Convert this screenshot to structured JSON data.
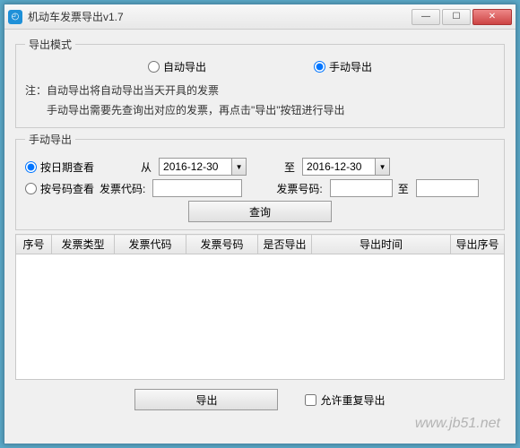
{
  "window": {
    "title": "机动车发票导出v1.7"
  },
  "export_mode": {
    "legend": "导出模式",
    "auto_label": "自动导出",
    "manual_label": "手动导出",
    "selected": "manual",
    "note_line1": "注：自动导出将自动导出当天开具的发票",
    "note_line2": "手动导出需要先查询出对应的发票，再点击\"导出\"按钮进行导出"
  },
  "manual_export": {
    "legend": "手动导出",
    "by_date_label": "按日期查看",
    "by_number_label": "按号码查看",
    "selected": "date",
    "from_label": "从",
    "to_label": "至",
    "date_from": "2016-12-30",
    "date_to": "2016-12-30",
    "invoice_code_label": "发票代码:",
    "invoice_no_label": "发票号码:",
    "to2_label": "至",
    "query_button": "查询"
  },
  "table": {
    "headers": [
      "序号",
      "发票类型",
      "发票代码",
      "发票号码",
      "是否导出",
      "导出时间",
      "导出序号"
    ]
  },
  "bottom": {
    "export_button": "导出",
    "allow_reexport_label": "允许重复导出"
  },
  "watermark": "www.jb51.net"
}
